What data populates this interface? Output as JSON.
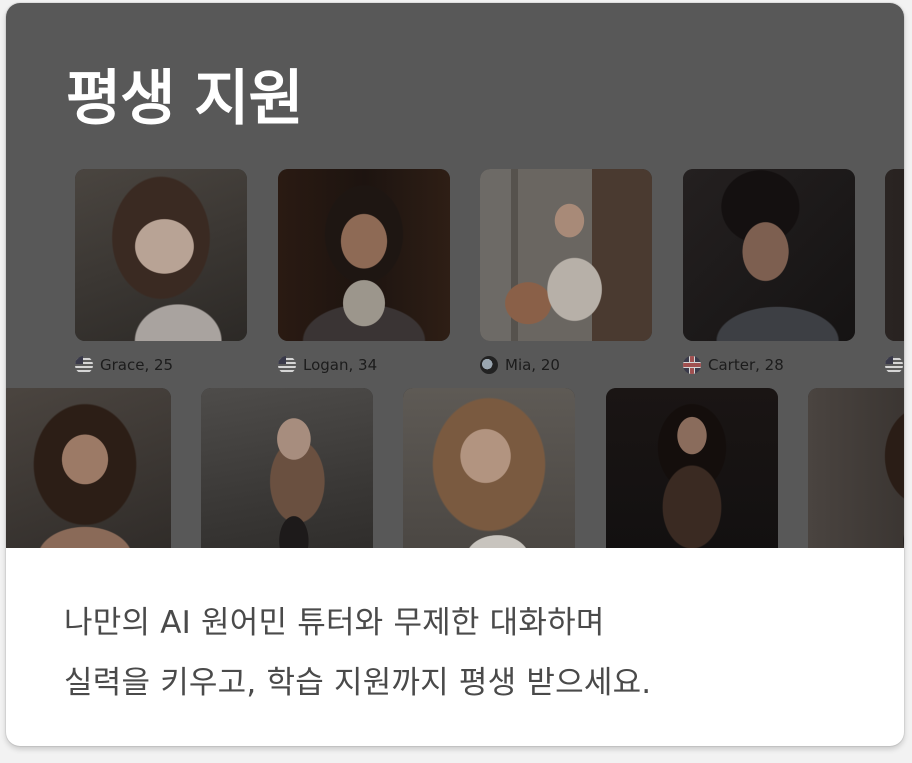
{
  "card": {
    "title": "평생 지원",
    "description_lines": [
      "나만의 AI 원어민 튜터와 무제한 대화하며",
      "실력을 키우고, 학습 지원까지 평생 받으세요."
    ]
  },
  "tutors_row1": [
    {
      "name": "Grace, 25",
      "flag_icon": "us-flag-icon"
    },
    {
      "name": "Logan, 34",
      "flag_icon": "us-flag-icon"
    },
    {
      "name": "Mia, 20",
      "flag_icon": "india-flag-icon"
    },
    {
      "name": "Carter, 28",
      "flag_icon": "uk-flag-icon"
    },
    {
      "name": "",
      "flag_icon": "us-flag-icon"
    }
  ],
  "tutors_row2_count_visible": 5,
  "colors": {
    "hero_overlay": "#585858",
    "title_text": "#ffffff",
    "description_text": "#4a4a4a",
    "card_background": "#ffffff"
  }
}
